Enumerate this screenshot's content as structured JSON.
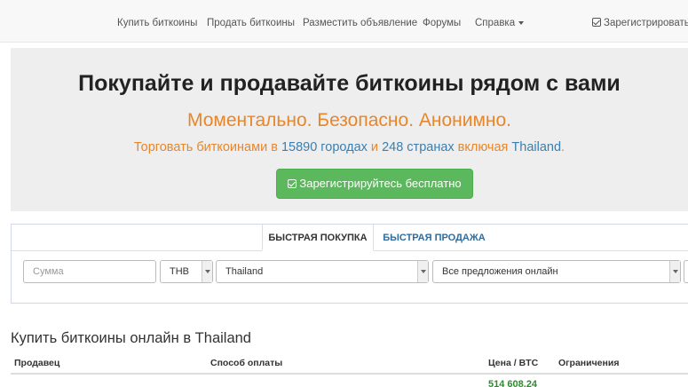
{
  "nav": {
    "items": [
      {
        "label": "Купить биткоины"
      },
      {
        "label": "Продать биткоины"
      },
      {
        "label": "Разместить объявление"
      },
      {
        "label": "Форумы"
      },
      {
        "label": "Справка"
      }
    ],
    "register_label": "Зарегистрироваться"
  },
  "hero": {
    "title": "Покупайте и продавайте биткоины рядом с вами",
    "subtitle": "Моментально. Безопасно. Анонимно.",
    "line_prefix": "Торговать биткоинами в ",
    "city_count": "15890 городах",
    "line_and": " и ",
    "country_count": "248 странах",
    "line_including": " включая ",
    "country": "Thailand",
    "line_end": ".",
    "signup_label": "Зарегистрируйтесь бесплатно"
  },
  "search": {
    "tab_buy": "БЫСТРАЯ ПОКУПКА",
    "tab_sell": "БЫСТРАЯ ПРОДАЖА",
    "amount_placeholder": "Сумма",
    "currency": "THB",
    "country": "Thailand",
    "offers": "Все предложения онлайн"
  },
  "listing": {
    "title": "Купить биткоины онлайн в Thailand",
    "columns": {
      "seller": "Продавец",
      "payment": "Способ оплаты",
      "price": "Цена / BTC",
      "limits": "Ограничения"
    },
    "rows": [
      {
        "price": "514 608,24"
      }
    ]
  },
  "colors": {
    "accent_orange": "#e8862a",
    "link_blue": "#3a7fb0",
    "success_green": "#5cb85c"
  }
}
